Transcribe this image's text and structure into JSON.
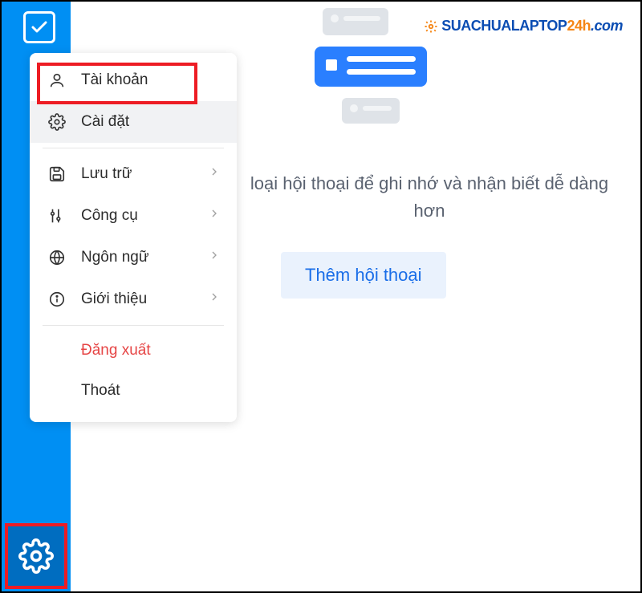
{
  "menu": {
    "account": "Tài khoản",
    "settings": "Cài đặt",
    "storage": "Lưu trữ",
    "tools": "Công cụ",
    "language": "Ngôn ngữ",
    "about": "Giới thiệu",
    "logout": "Đăng xuất",
    "exit": "Thoát"
  },
  "main": {
    "hint": "loại hội thoại để ghi nhớ và nhận biết dễ dàng hơn",
    "add_button": "Thêm hội thoại"
  },
  "watermark": {
    "part1": "SUACHUALAPTOP",
    "part2": "24h",
    "part3": ".com"
  }
}
